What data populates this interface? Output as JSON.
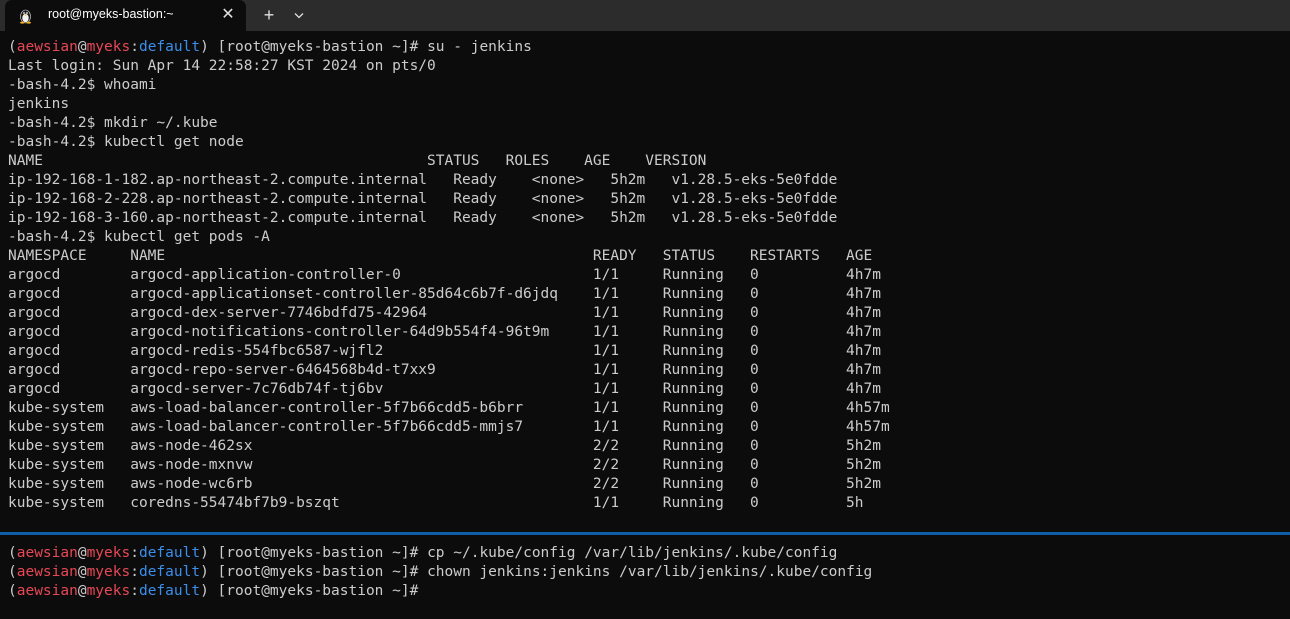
{
  "tab": {
    "title": "root@myeks-bastion:~",
    "icon": "linux-penguin-icon",
    "close_glyph": "✕"
  },
  "tabbar": {
    "new_tab_glyph": "+",
    "dropdown_icon": "chevron-down-icon"
  },
  "prompt": {
    "open": "(",
    "user": "aewsian",
    "at": "@",
    "host": "myeks",
    "colon": ":",
    "context": "default",
    "close": ")",
    "shell": " [root@myeks-bastion ~]# "
  },
  "colors": {
    "background": "#0c0c0c",
    "text": "#cccccc",
    "prompt_user": "#e74856",
    "prompt_context": "#3b8eea",
    "divider": "#0e5fa8"
  },
  "top_pane": {
    "lines": [
      {
        "prompt": true,
        "command": "su - jenkins"
      },
      {
        "text": "Last login: Sun Apr 14 22:58:27 KST 2024 on pts/0"
      },
      {
        "text": "-bash-4.2$ whoami"
      },
      {
        "text": "jenkins"
      },
      {
        "text": "-bash-4.2$ mkdir ~/.kube"
      },
      {
        "text": "-bash-4.2$ kubectl get node"
      },
      {
        "text": "NAME                                            STATUS   ROLES    AGE    VERSION"
      },
      {
        "text": "ip-192-168-1-182.ap-northeast-2.compute.internal   Ready    <none>   5h2m   v1.28.5-eks-5e0fdde"
      },
      {
        "text": "ip-192-168-2-228.ap-northeast-2.compute.internal   Ready    <none>   5h2m   v1.28.5-eks-5e0fdde"
      },
      {
        "text": "ip-192-168-3-160.ap-northeast-2.compute.internal   Ready    <none>   5h2m   v1.28.5-eks-5e0fdde"
      },
      {
        "text": "-bash-4.2$ kubectl get pods -A"
      },
      {
        "text": "NAMESPACE     NAME                                                 READY   STATUS    RESTARTS   AGE"
      },
      {
        "text": "argocd        argocd-application-controller-0                      1/1     Running   0          4h7m"
      },
      {
        "text": "argocd        argocd-applicationset-controller-85d64c6b7f-d6jdq    1/1     Running   0          4h7m"
      },
      {
        "text": "argocd        argocd-dex-server-7746bdfd75-42964                   1/1     Running   0          4h7m"
      },
      {
        "text": "argocd        argocd-notifications-controller-64d9b554f4-96t9m     1/1     Running   0          4h7m"
      },
      {
        "text": "argocd        argocd-redis-554fbc6587-wjfl2                        1/1     Running   0          4h7m"
      },
      {
        "text": "argocd        argocd-repo-server-6464568b4d-t7xx9                  1/1     Running   0          4h7m"
      },
      {
        "text": "argocd        argocd-server-7c76db74f-tj6bv                        1/1     Running   0          4h7m"
      },
      {
        "text": "kube-system   aws-load-balancer-controller-5f7b66cdd5-b6brr        1/1     Running   0          4h57m"
      },
      {
        "text": "kube-system   aws-load-balancer-controller-5f7b66cdd5-mmjs7        1/1     Running   0          4h57m"
      },
      {
        "text": "kube-system   aws-node-462sx                                       2/2     Running   0          5h2m"
      },
      {
        "text": "kube-system   aws-node-mxnvw                                       2/2     Running   0          5h2m"
      },
      {
        "text": "kube-system   aws-node-wc6rb                                       2/2     Running   0          5h2m"
      },
      {
        "text": "kube-system   coredns-55474bf7b9-bszqt                             1/1     Running   0          5h"
      }
    ]
  },
  "bottom_pane": {
    "lines": [
      {
        "prompt": true,
        "command": "cp ~/.kube/config /var/lib/jenkins/.kube/config"
      },
      {
        "prompt": true,
        "command": "chown jenkins:jenkins /var/lib/jenkins/.kube/config"
      },
      {
        "prompt": true,
        "command": ""
      }
    ]
  }
}
